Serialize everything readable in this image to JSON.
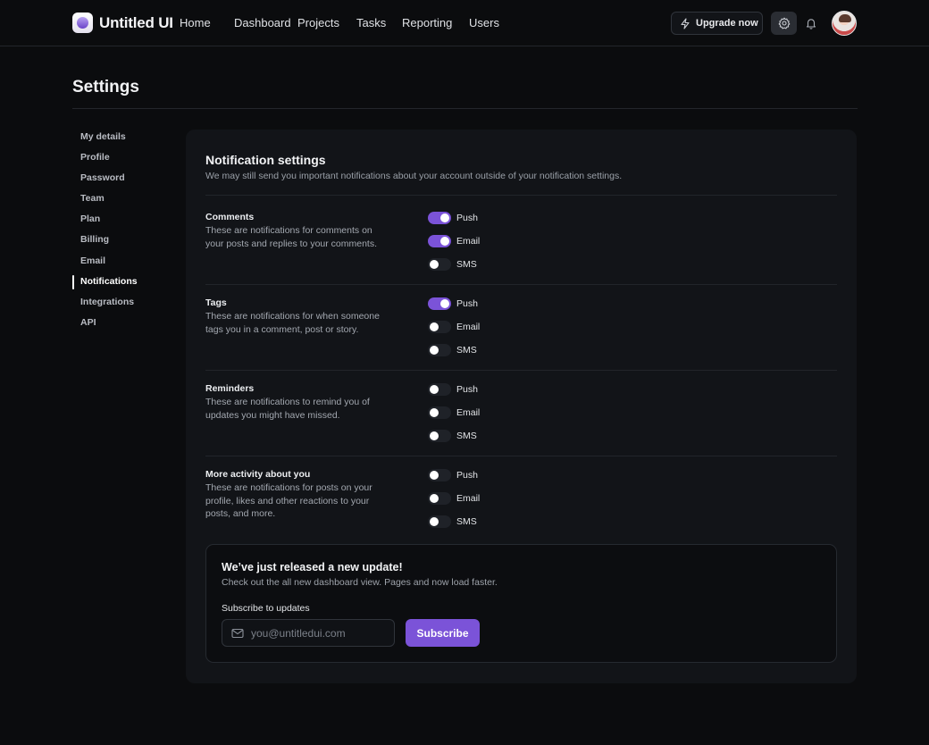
{
  "app": {
    "name": "Untitled UI"
  },
  "nav": {
    "links": [
      "Home",
      "Dashboard",
      "Projects",
      "Tasks",
      "Reporting",
      "Users"
    ],
    "upgrade_label": "Upgrade now"
  },
  "page": {
    "title": "Settings"
  },
  "sidenav": {
    "items": [
      "My details",
      "Profile",
      "Password",
      "Team",
      "Plan",
      "Billing",
      "Email",
      "Notifications",
      "Integrations",
      "API"
    ],
    "active": "Notifications"
  },
  "notifications": {
    "title": "Notification settings",
    "subtitle": "We may still send you important notifications about your account outside of your notification settings.",
    "groups": [
      {
        "title": "Comments",
        "description": "These are notifications for comments on your posts and replies to your comments.",
        "options": [
          {
            "label": "Push",
            "on": true
          },
          {
            "label": "Email",
            "on": true
          },
          {
            "label": "SMS",
            "on": false
          }
        ]
      },
      {
        "title": "Tags",
        "description": "These are notifications for when someone tags you in a comment, post or story.",
        "options": [
          {
            "label": "Push",
            "on": true
          },
          {
            "label": "Email",
            "on": false
          },
          {
            "label": "SMS",
            "on": false
          }
        ]
      },
      {
        "title": "Reminders",
        "description": "These are notifications to remind you of updates you might have missed.",
        "options": [
          {
            "label": "Push",
            "on": false
          },
          {
            "label": "Email",
            "on": false
          },
          {
            "label": "SMS",
            "on": false
          }
        ]
      },
      {
        "title": "More activity about you",
        "description": "These are notifications for posts on your profile, likes and other reactions to your posts, and more.",
        "options": [
          {
            "label": "Push",
            "on": false
          },
          {
            "label": "Email",
            "on": false
          },
          {
            "label": "SMS",
            "on": false
          }
        ]
      }
    ]
  },
  "update": {
    "title": "We’ve just released a new update!",
    "subtitle": "Check out the all new dashboard view. Pages and now load faster.",
    "subscribe_label": "Subscribe to updates",
    "email_placeholder": "you@untitledui.com",
    "email_value": "",
    "button_label": "Subscribe"
  },
  "colors": {
    "accent": "#7b53d8",
    "background": "#0b0c0e",
    "card": "#121418"
  },
  "icons": {
    "upgrade": "lightning-icon",
    "settings": "gear-icon",
    "notifications": "bell-icon",
    "email": "mail-icon"
  }
}
